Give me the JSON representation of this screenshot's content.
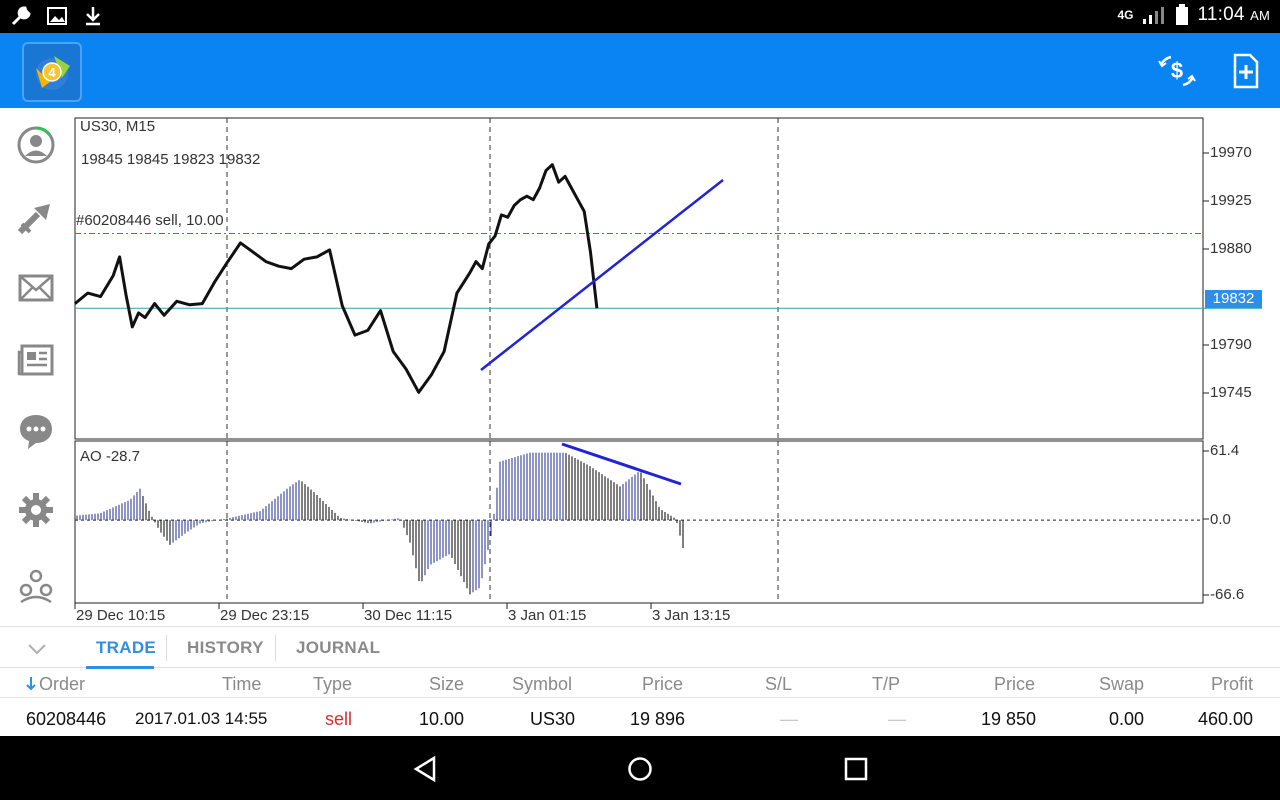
{
  "status_bar": {
    "time": "11:04",
    "ampm": "AM",
    "network": "4G",
    "icons": [
      "wrench-icon",
      "image-icon",
      "download-icon",
      "network-icon",
      "signal-icon",
      "battery-icon"
    ]
  },
  "app_bar": {
    "logo": "metatrader-4-logo",
    "actions": [
      "currency-exchange-icon",
      "new-order-icon"
    ]
  },
  "left_nav": {
    "items": [
      "account-icon",
      "trade-arrows-icon",
      "mail-icon",
      "news-icon",
      "chat-icon",
      "settings-icon",
      "community-icon"
    ]
  },
  "chart": {
    "symbol_label": "US30, M15",
    "ohlc_label": "19845 19845 19823 19832",
    "order_label": "#60208446 sell, 10.00",
    "current_price": "19832",
    "indicator_label": "AO -28.7",
    "y_ticks": [
      "19970",
      "19925",
      "19880",
      "19790",
      "19745"
    ],
    "ao_ticks": [
      "61.4",
      "0.0",
      "-66.6"
    ],
    "x_ticks": [
      "29 Dec 10:15",
      "29 Dec 23:15",
      "30 Dec 11:15",
      "3 Jan 01:15",
      "3 Jan 13:15"
    ],
    "colors": {
      "price_line": "#111111",
      "trend_line": "#2323d6",
      "order_line": "#b5533c",
      "bid_line": "#2aa7a7",
      "histogram_up": "#1e2a8c",
      "histogram_down": "#000000"
    }
  },
  "chart_data": {
    "type": "line",
    "title": "US30, M15",
    "ylim": [
      19720,
      19995
    ],
    "last_price": 19832,
    "order_price": 19896,
    "grid": false,
    "series": [
      {
        "name": "US30",
        "x_index": [
          0,
          4,
          8,
          12,
          14,
          16,
          18,
          20,
          22,
          25,
          28,
          32,
          36,
          40,
          44,
          48,
          52,
          56,
          60,
          64,
          68,
          72,
          76,
          80,
          84,
          88,
          92,
          96,
          100,
          104,
          108,
          112,
          116,
          120,
          124,
          126,
          128,
          130,
          132,
          134,
          136,
          138,
          140,
          142,
          144,
          146,
          148,
          150,
          152,
          154,
          156,
          158,
          160,
          162,
          164,
          166,
          168,
          170,
          172,
          174,
          176,
          178,
          180,
          182,
          184,
          186,
          188,
          190,
          192
        ],
        "values": [
          19836,
          19845,
          19842,
          19860,
          19876,
          19844,
          19816,
          19828,
          19824,
          19836,
          19826,
          19838,
          19835,
          19836,
          19855,
          19872,
          19888,
          19880,
          19872,
          19868,
          19866,
          19874,
          19876,
          19882,
          19834,
          19809,
          19813,
          19830,
          19795,
          19780,
          19760,
          19775,
          19795,
          19845,
          19862,
          19872,
          19866,
          19887,
          19894,
          19912,
          19910,
          19920,
          19925,
          19928,
          19925,
          19935,
          19950,
          19955,
          19940,
          19945,
          19935,
          19925,
          19915,
          19880,
          19832
        ]
      }
    ],
    "indicator": {
      "name": "AO",
      "last": -28.7,
      "ylim": [
        -66.6,
        61.4
      ]
    }
  },
  "bottom_panel": {
    "tabs": [
      "TRADE",
      "HISTORY",
      "JOURNAL"
    ],
    "active_tab": "TRADE",
    "columns": {
      "order": "Order",
      "time": "Time",
      "type": "Type",
      "size": "Size",
      "symbol": "Symbol",
      "price": "Price",
      "sl": "S/L",
      "tp": "T/P",
      "cur_price": "Price",
      "swap": "Swap",
      "profit": "Profit"
    },
    "row": {
      "order": "60208446",
      "time": "2017.01.03 14:55",
      "type": "sell",
      "size": "10.00",
      "symbol": "US30",
      "price": "19 896",
      "sl": "—",
      "tp": "—",
      "cur_price": "19 850",
      "swap": "0.00",
      "profit": "460.00"
    }
  },
  "nav_bar": {
    "buttons": [
      "back-icon",
      "home-icon",
      "recents-icon"
    ]
  }
}
